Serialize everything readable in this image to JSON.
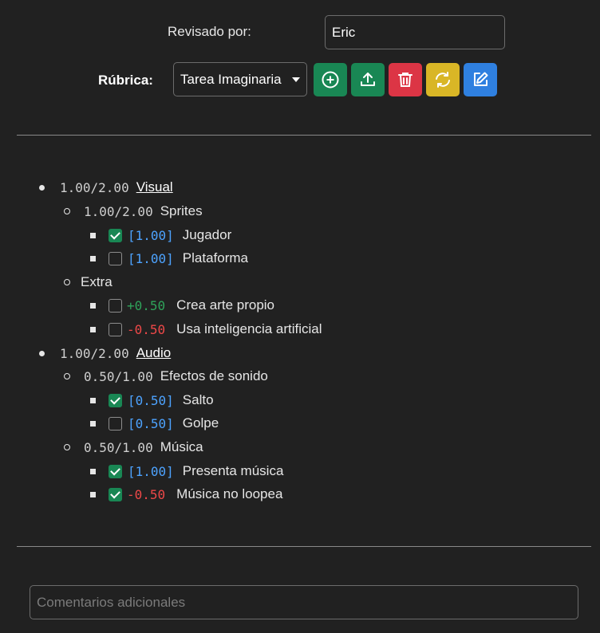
{
  "reviewer": {
    "label": "Revisado por:",
    "value": "Eric"
  },
  "rubric": {
    "label": "Rúbrica:",
    "selected": "Tarea Imaginaria",
    "buttons": [
      {
        "name": "add-button",
        "icon": "plus-circle-icon",
        "color": "#198754"
      },
      {
        "name": "upload-button",
        "icon": "upload-icon",
        "color": "#198754"
      },
      {
        "name": "delete-button",
        "icon": "trash-icon",
        "color": "#dc3545"
      },
      {
        "name": "refresh-button",
        "icon": "refresh-icon",
        "color": "#d9b626"
      },
      {
        "name": "edit-button",
        "icon": "edit-icon",
        "color": "#2f80e0"
      }
    ]
  },
  "categories": [
    {
      "score": "1.00/2.00",
      "name": "Visual",
      "groups": [
        {
          "score": "1.00/2.00",
          "name": "Sprites",
          "items": [
            {
              "value": "[1.00]",
              "label": "Jugador",
              "checked": true,
              "kind": "blue"
            },
            {
              "value": "[1.00]",
              "label": "Plataforma",
              "checked": false,
              "kind": "blue"
            }
          ]
        },
        {
          "score": "",
          "name": "Extra",
          "items": [
            {
              "value": "+0.50",
              "label": "Crea arte propio",
              "checked": false,
              "kind": "green"
            },
            {
              "value": "-0.50",
              "label": "Usa inteligencia artificial",
              "checked": false,
              "kind": "red"
            }
          ]
        }
      ]
    },
    {
      "score": "1.00/2.00",
      "name": "Audio",
      "groups": [
        {
          "score": "0.50/1.00",
          "name": "Efectos de sonido",
          "items": [
            {
              "value": "[0.50]",
              "label": "Salto",
              "checked": true,
              "kind": "blue"
            },
            {
              "value": "[0.50]",
              "label": "Golpe",
              "checked": false,
              "kind": "blue"
            }
          ]
        },
        {
          "score": "0.50/1.00",
          "name": "Música",
          "items": [
            {
              "value": "[1.00]",
              "label": "Presenta música",
              "checked": true,
              "kind": "blue"
            },
            {
              "value": "-0.50",
              "label": "Música no loopea",
              "checked": true,
              "kind": "red"
            }
          ]
        }
      ]
    }
  ],
  "comments": {
    "placeholder": "Comentarios adicionales"
  }
}
